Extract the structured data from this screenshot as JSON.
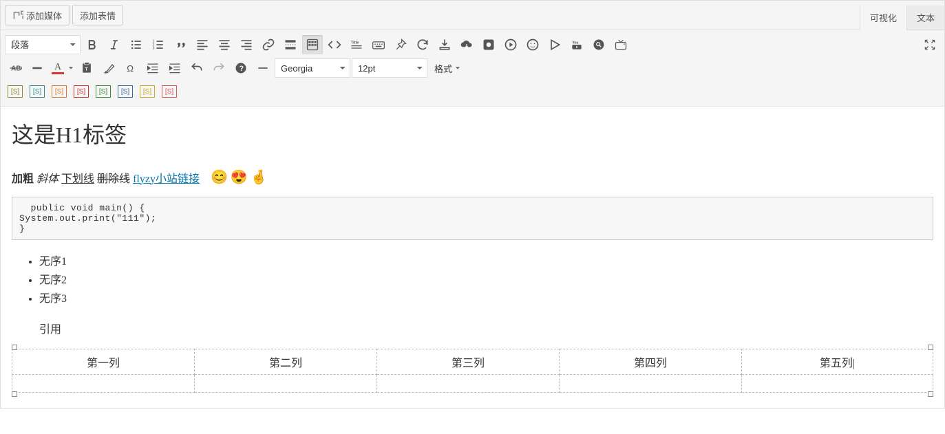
{
  "top": {
    "add_media": "添加媒体",
    "add_emoji": "添加表情",
    "tab_visual": "可视化",
    "tab_text": "文本"
  },
  "toolbar": {
    "format_select": "段落",
    "font_family": "Georgia",
    "font_size": "12pt",
    "format_label": "格式"
  },
  "content": {
    "h1": "这是H1标签",
    "bold": "加粗",
    "italic": "斜体",
    "underline": "下划线",
    "strike": "删除线",
    "link": "flyzy小站链接",
    "code": "  public void main() {\nSystem.out.print(\"111\");\n}",
    "ul": [
      "无序1",
      "无序2",
      "无序3"
    ],
    "quote": "引用",
    "cols": [
      "第一列",
      "第二列",
      "第三列",
      "第四列",
      "第五列"
    ]
  }
}
